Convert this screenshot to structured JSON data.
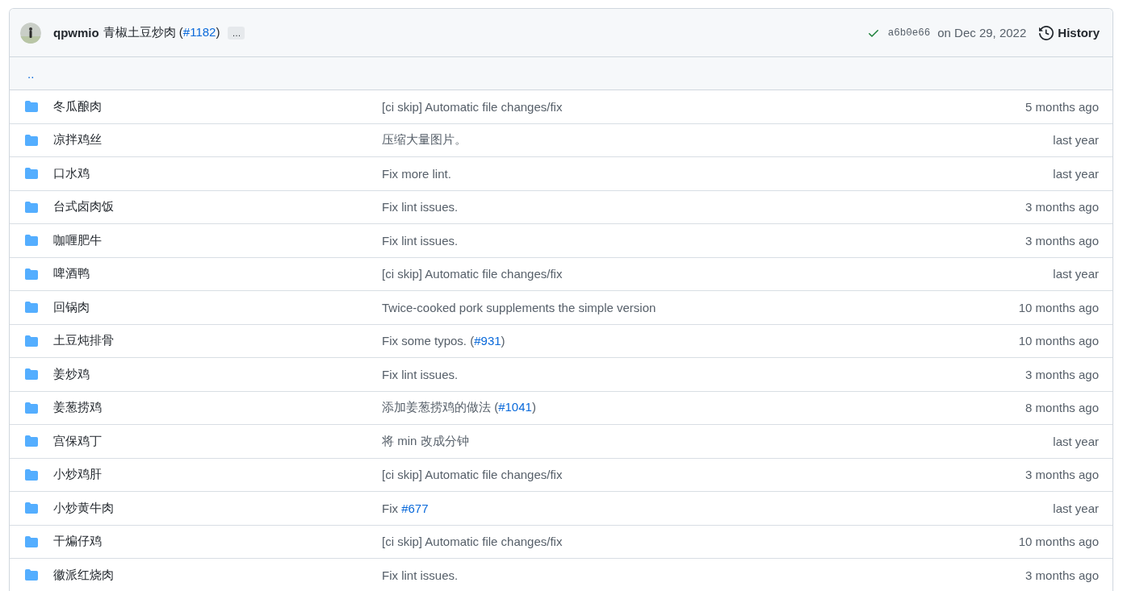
{
  "latest_commit": {
    "author": "qpwmio",
    "message": [
      {
        "text": "青椒土豆炒肉 ("
      },
      {
        "text": "#1182",
        "kind": "link"
      },
      {
        "text": ")"
      }
    ],
    "more": "…",
    "checks_passed": true,
    "sha": "a6b0e66",
    "date": "on Dec 29, 2022",
    "history": "History"
  },
  "parent_link": "..",
  "rows": [
    {
      "name": "冬瓜酿肉",
      "message": [
        {
          "text": "[ci skip] Automatic file changes/fix"
        }
      ],
      "age": "5 months ago"
    },
    {
      "name": "凉拌鸡丝",
      "message": [
        {
          "text": "压缩大量图片。"
        }
      ],
      "age": "last year"
    },
    {
      "name": "口水鸡",
      "message": [
        {
          "text": "Fix more lint."
        }
      ],
      "age": "last year"
    },
    {
      "name": "台式卤肉饭",
      "message": [
        {
          "text": "Fix lint issues."
        }
      ],
      "age": "3 months ago"
    },
    {
      "name": "咖喱肥牛",
      "message": [
        {
          "text": "Fix lint issues."
        }
      ],
      "age": "3 months ago"
    },
    {
      "name": "啤酒鸭",
      "message": [
        {
          "text": "[ci skip] Automatic file changes/fix"
        }
      ],
      "age": "last year"
    },
    {
      "name": "回锅肉",
      "message": [
        {
          "text": "Twice-cooked pork supplements the simple version"
        }
      ],
      "age": "10 months ago"
    },
    {
      "name": "土豆炖排骨",
      "message": [
        {
          "text": "Fix some typos. ("
        },
        {
          "text": "#931",
          "kind": "link"
        },
        {
          "text": ")"
        }
      ],
      "age": "10 months ago"
    },
    {
      "name": "姜炒鸡",
      "message": [
        {
          "text": "Fix lint issues."
        }
      ],
      "age": "3 months ago"
    },
    {
      "name": "姜葱捞鸡",
      "message": [
        {
          "text": "添加姜葱捞鸡的做法 ("
        },
        {
          "text": "#1041",
          "kind": "link"
        },
        {
          "text": ")"
        }
      ],
      "age": "8 months ago"
    },
    {
      "name": "宫保鸡丁",
      "message": [
        {
          "text": "将 min 改成分钟"
        }
      ],
      "age": "last year"
    },
    {
      "name": "小炒鸡肝",
      "message": [
        {
          "text": "[ci skip] Automatic file changes/fix"
        }
      ],
      "age": "3 months ago"
    },
    {
      "name": "小炒黄牛肉",
      "message": [
        {
          "text": "Fix "
        },
        {
          "text": "#677",
          "kind": "link"
        }
      ],
      "age": "last year"
    },
    {
      "name": "干煸仔鸡",
      "message": [
        {
          "text": "[ci skip] Automatic file changes/fix"
        }
      ],
      "age": "10 months ago"
    },
    {
      "name": "徽派红烧肉",
      "message": [
        {
          "text": "Fix lint issues."
        }
      ],
      "age": "3 months ago"
    }
  ]
}
